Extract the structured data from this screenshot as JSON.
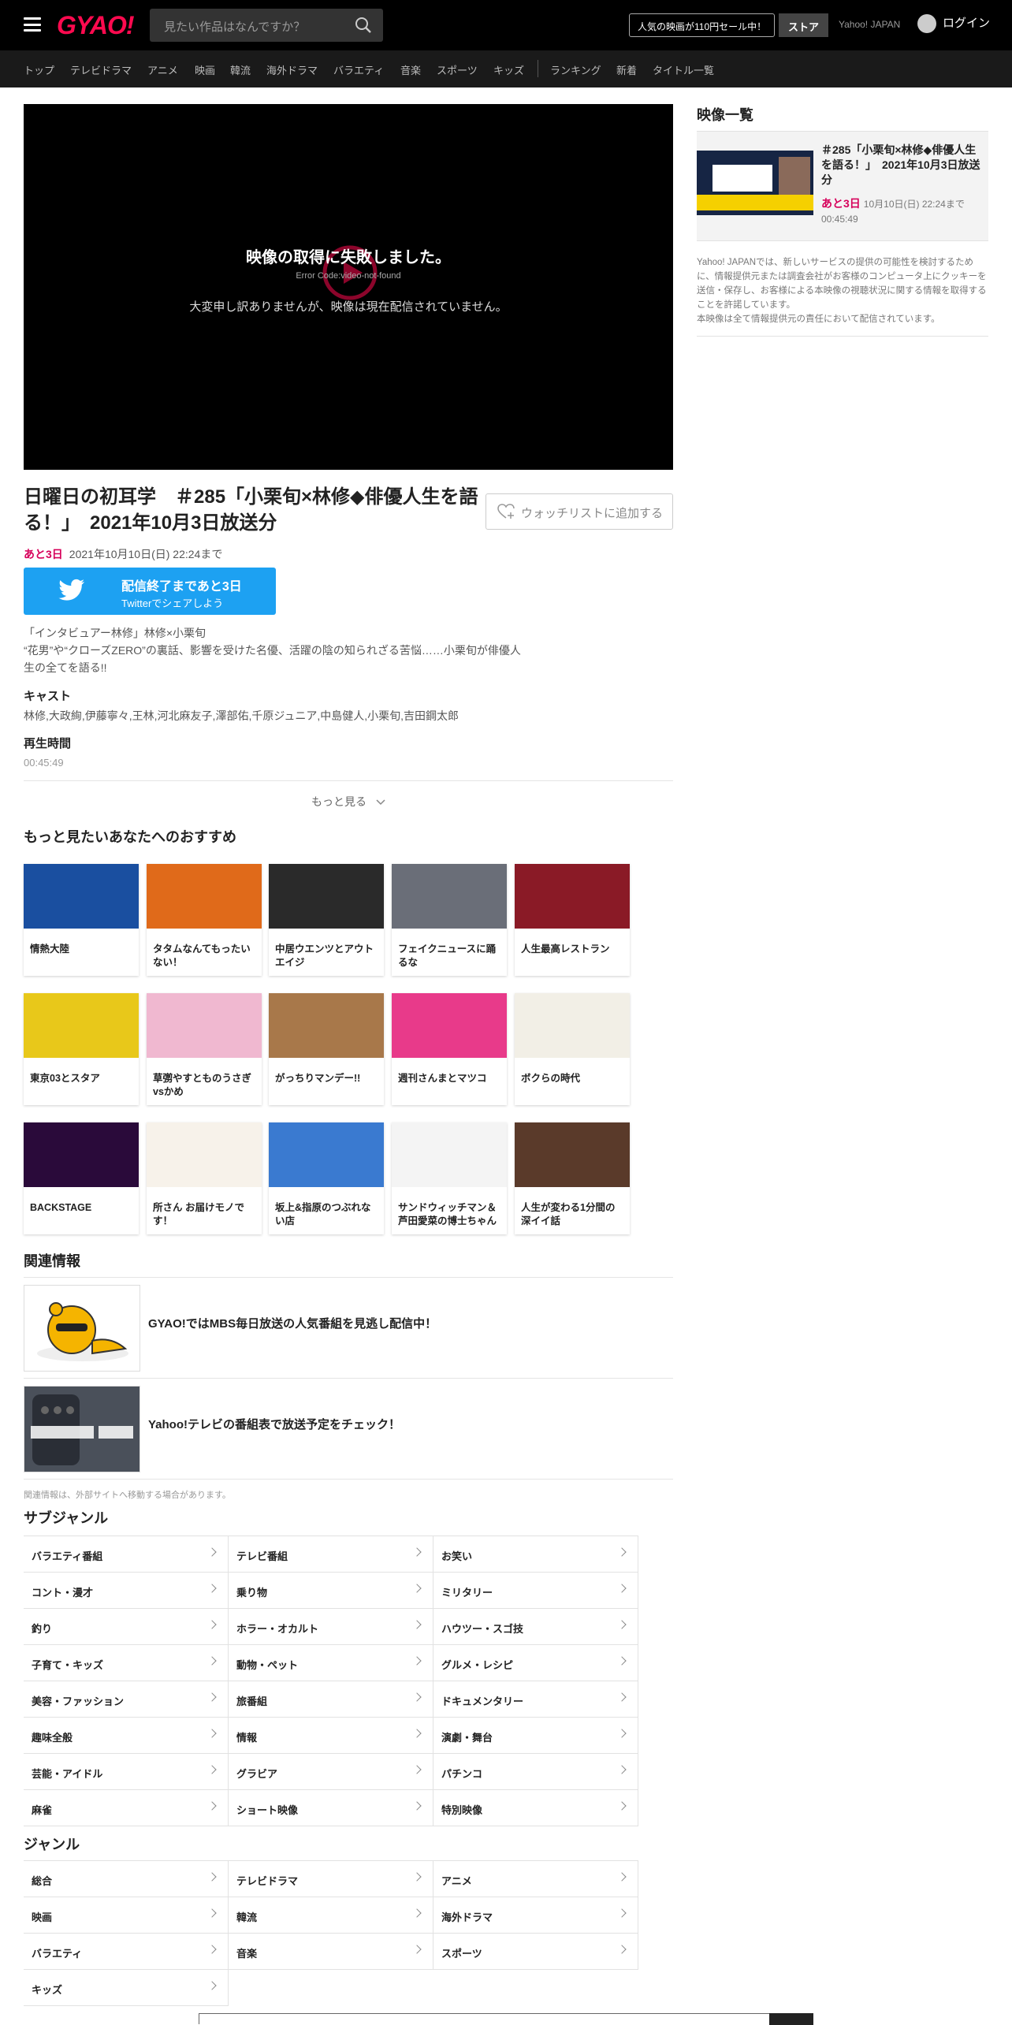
{
  "header": {
    "logo": "GYAO!",
    "search_placeholder": "見たい作品はなんですか？",
    "promo": "人気の映画が110円セール中！",
    "store": "ストア",
    "yahoo": "Yahoo! JAPAN",
    "login": "ログイン"
  },
  "nav": {
    "items": [
      "トップ",
      "テレビドラマ",
      "アニメ",
      "映画",
      "韓流",
      "海外ドラマ",
      "バラエティ",
      "音楽",
      "スポーツ",
      "キッズ",
      "ランキング",
      "新着",
      "タイトル一覧"
    ]
  },
  "player": {
    "error_title": "映像の取得に失敗しました。",
    "error_code": "Error Code:video-not-found",
    "error_detail": "大変申し訳ありませんが、映像は現在配信されていません。"
  },
  "video": {
    "title": "日曜日の初耳学　＃285「小栗旬×林修◆俳優人生を語る！」　2021年10月3日放送分",
    "watchlist": "ウォッチリストに追加する",
    "remaining": "あと3日",
    "deadline": "2021年10月10日(日) 22:24まで",
    "twitter_l1": "配信終了まであと3日",
    "twitter_l2": "Twitterでシェアしよう",
    "desc_1": "「インタビュアー林修」林修×小栗旬",
    "desc_2": "“花男”や“クローズZERO”の裏話、影響を受けた名優、活躍の陰の知られざる苦悩……小栗旬が俳優人生の全てを語る!!",
    "cast_label": "キャスト",
    "cast": "林修,大政絢,伊藤寧々,王林,河北麻友子,澤部佑,千原ジュニア,中島健人,小栗旬,吉田鋼太郎",
    "duration_label": "再生時間",
    "duration": "00:45:49",
    "more": "もっと見る"
  },
  "recommend": {
    "heading": "もっと見たいあなたへのおすすめ",
    "items": [
      {
        "title": "情熱大陸",
        "color": "#1a4fa0"
      },
      {
        "title": "タタムなんてもったいない！",
        "color": "#e06a1a"
      },
      {
        "title": "中居ウエンツとアウトエイジ",
        "color": "#2a2a2a"
      },
      {
        "title": "フェイクニュースに踊るな",
        "color": "#6a6e78"
      },
      {
        "title": "人生最高レストラン",
        "color": "#8a1a26"
      },
      {
        "title": "東京03とスタア",
        "color": "#e8c81a"
      },
      {
        "title": "草彅やすとものうさぎvsかめ",
        "color": "#f0b8d0"
      },
      {
        "title": "がっちりマンデー!!",
        "color": "#a8784a"
      },
      {
        "title": "週刊さんまとマツコ",
        "color": "#e83a8a"
      },
      {
        "title": "ボクらの時代",
        "color": "#f2efe6"
      },
      {
        "title": "BACKSTAGE",
        "color": "#2a0a3a"
      },
      {
        "title": "所さん お届けモノです！",
        "color": "#f7f2ea"
      },
      {
        "title": "坂上&指原のつぶれない店",
        "color": "#3a7ad0"
      },
      {
        "title": "サンドウィッチマン＆芦田愛菜の博士ちゃん",
        "color": "#f4f4f4"
      },
      {
        "title": "人生が変わる1分間の深イイ話",
        "color": "#5a3a2a"
      }
    ]
  },
  "related": {
    "heading": "関連情報",
    "items": [
      {
        "text": "GYAO!ではMBS毎日放送の人気番組を見逃し配信中！"
      },
      {
        "text": "Yahoo!テレビの番組表で放送予定をチェック！"
      }
    ],
    "note": "関連情報は、外部サイトへ移動する場合があります。"
  },
  "subgenre": {
    "heading": "サブジャンル",
    "items": [
      "バラエティ番組",
      "テレビ番組",
      "お笑い",
      "コント・漫才",
      "乗り物",
      "ミリタリー",
      "釣り",
      "ホラー・オカルト",
      "ハウツー・スゴ技",
      "子育て・キッズ",
      "動物・ペット",
      "グルメ・レシピ",
      "美容・ファッション",
      "旅番組",
      "ドキュメンタリー",
      "趣味全般",
      "情報",
      "演劇・舞台",
      "芸能・アイドル",
      "グラビア",
      "パチンコ",
      "麻雀",
      "ショート映像",
      "特別映像"
    ]
  },
  "genre": {
    "heading": "ジャンル",
    "items": [
      "総合",
      "テレビドラマ",
      "アニメ",
      "映画",
      "韓流",
      "海外ドラマ",
      "バラエティ",
      "音楽",
      "スポーツ",
      "キッズ"
    ]
  },
  "sidebar": {
    "heading": "映像一覧",
    "card_title": "＃285「小栗旬×林修◆俳優人生を語る！」　2021年10月3日放送分",
    "card_remaining": "あと3日",
    "card_deadline": "10月10日(日) 22:24まで",
    "card_duration": "00:45:49",
    "notice_1": "Yahoo! JAPANでは、新しいサービスの提供の可能性を検討するために、情報提供元または調査会社がお客様のコンピュータ上にクッキーを送信・保存し、お客様による本映像の視聴状況に関する情報を取得することを許諾しています。",
    "notice_2": "本映像は全て情報提供元の責任において配信されています。"
  }
}
